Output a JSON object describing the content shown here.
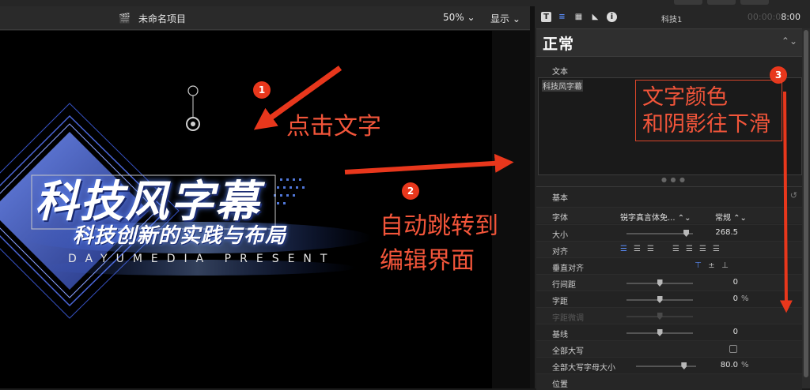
{
  "viewer": {
    "project_title": "未命名项目",
    "zoom": "50%",
    "zoom_chevron": "⌄",
    "display_menu": "显示",
    "display_chevron": "⌄",
    "overlay_title": "科技风字幕",
    "overlay_subtitle": "科技创新的实践与布局",
    "overlay_tagline": "DAYUMEDIA PRESENT"
  },
  "inspector": {
    "tabs": [
      "T",
      "≡",
      "▦",
      "◣",
      "i"
    ],
    "clip_name": "科技1",
    "timecode_dim": "00:00:0",
    "timecode": "8:00",
    "preset": "正常",
    "preset_chevron": "⌃⌄",
    "text_section": "文本",
    "text_value": "科技风字幕",
    "basic_section": "基本",
    "reset_icon": "↺",
    "rows": {
      "font_label": "字体",
      "font_value": "锐字真言体免... ⌃⌄",
      "font_style": "常规 ⌃⌄",
      "size_label": "大小",
      "size_value": "268.5",
      "align_label": "对齐",
      "valign_label": "垂直对齐",
      "line_spacing_label": "行间距",
      "line_spacing_value": "0",
      "tracking_label": "字距",
      "tracking_value": "0",
      "tracking_unit": "%",
      "kerning_label": "字距微调",
      "baseline_label": "基线",
      "baseline_value": "0",
      "all_caps_label": "全部大写",
      "all_caps_size_label": "全部大写字母大小",
      "all_caps_size_value": "80.0",
      "all_caps_size_unit": "%",
      "position_label": "位置"
    },
    "levels": {
      "size_fraction": 0.9,
      "line_spacing_fraction": 0.5,
      "tracking_fraction": 0.5,
      "baseline_fraction": 0.5,
      "all_caps_size_fraction": 0.8
    }
  },
  "annotations": {
    "badge1": "1",
    "badge2": "2",
    "badge3": "3",
    "step1": "点击文字",
    "step2_line1": "自动跳转到",
    "step2_line2": "编辑界面",
    "step3_line1": "文字颜色",
    "step3_line2": "和阴影往下滑"
  },
  "colors": {
    "annotation_red": "#f2553a",
    "accent_blue": "#5b8dfa"
  }
}
